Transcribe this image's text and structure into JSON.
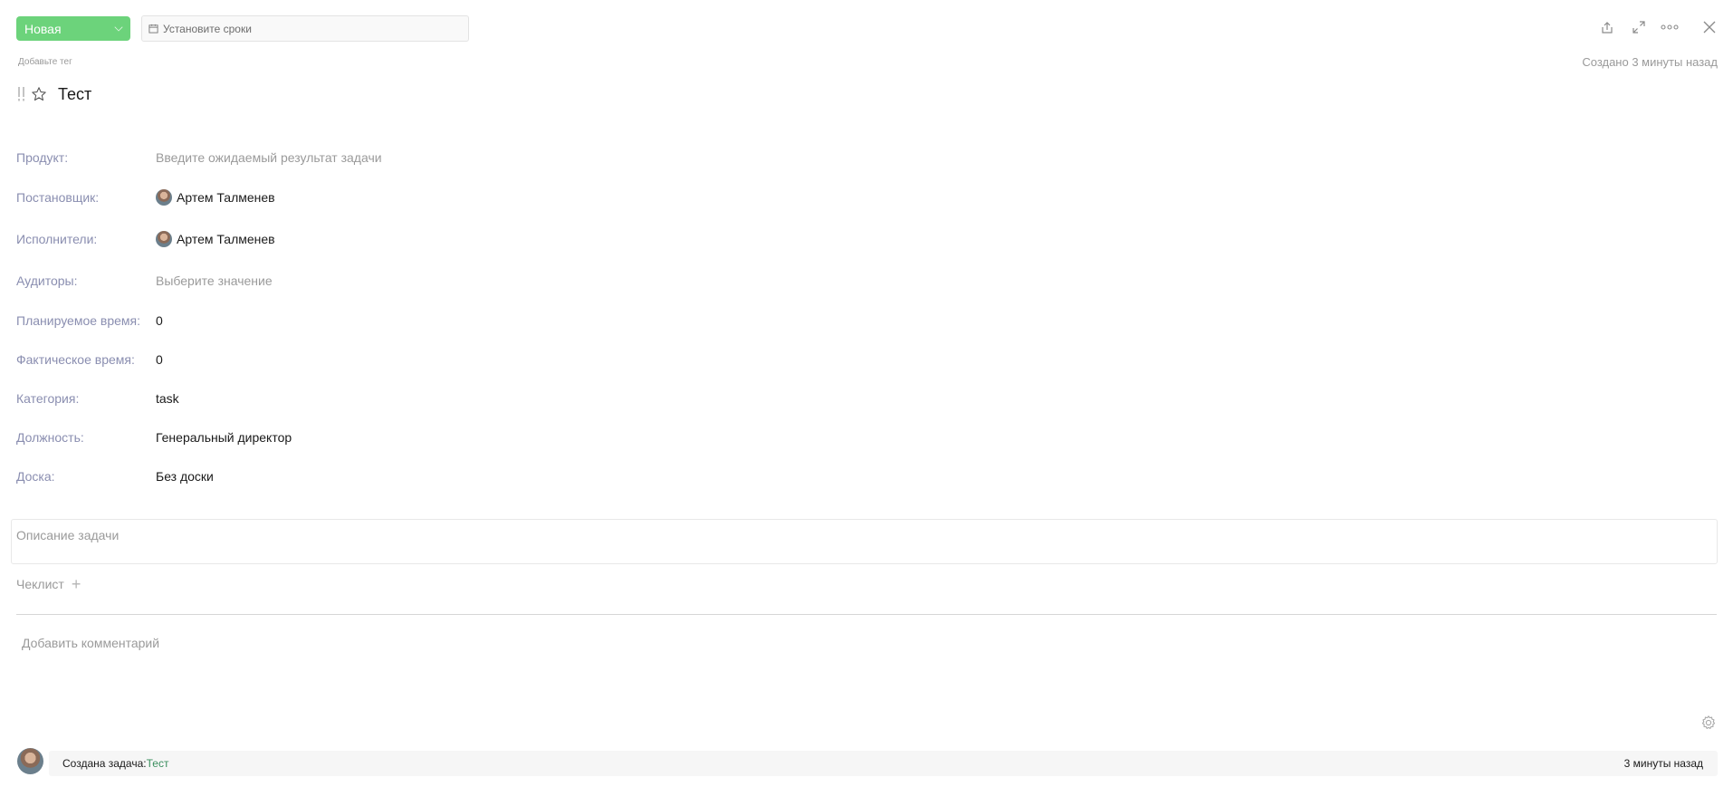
{
  "header": {
    "status_label": "Новая",
    "deadline_placeholder": "Установите сроки",
    "add_tag_label": "Добавьте тег",
    "created_meta": "Создано 3 минуты назад"
  },
  "task": {
    "title": "Тест"
  },
  "fields": {
    "product": {
      "label": "Продукт:",
      "value": "Введите ожидаемый результат задачи"
    },
    "author": {
      "label": "Постановщик:",
      "value": "Артем Талменев"
    },
    "assignees": {
      "label": "Исполнители:",
      "value": "Артем Талменев"
    },
    "auditors": {
      "label": "Аудиторы:",
      "value": "Выберите значение"
    },
    "planned_time": {
      "label": "Планируемое время:",
      "value": "0"
    },
    "actual_time": {
      "label": "Фактическое время:",
      "value": "0"
    },
    "category": {
      "label": "Категория:",
      "value": "task"
    },
    "position": {
      "label": "Должность:",
      "value": "Генеральный директор"
    },
    "board": {
      "label": "Доска:",
      "value": "Без доски"
    }
  },
  "description_placeholder": "Описание задачи",
  "checklist_label": "Чеклист",
  "checklist_add": "+",
  "comment_placeholder": "Добавить комментарий",
  "activity": {
    "text": "Создана задача:",
    "link": "Тест",
    "time": "3 минуты назад"
  },
  "colors": {
    "status_bg": "#6cd37b",
    "label": "#8a8eb0",
    "link": "#3a8e5e"
  }
}
